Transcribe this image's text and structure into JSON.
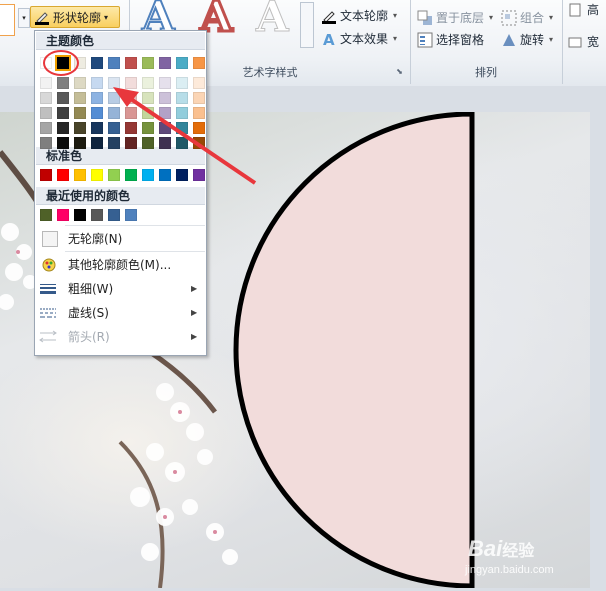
{
  "ribbon": {
    "shape_outline_label": "形状轮廓",
    "text_outline_label": "文本轮廓",
    "text_effects_label": "文本效果",
    "wordart_group_label": "艺术字样式",
    "send_to_back_label": "置于底层",
    "group_label": "组合",
    "selection_pane_label": "选择窗格",
    "rotate_label": "旋转",
    "arrange_group_label": "排列",
    "height_label": "高",
    "width_label": "宽",
    "wordart_glyph": "A"
  },
  "menu": {
    "theme_colors_header": "主题颜色",
    "standard_colors_header": "标准色",
    "recent_colors_header": "最近使用的颜色",
    "no_outline_label": "无轮廓(N)",
    "more_colors_label": "其他轮廓颜色(M)...",
    "weight_label": "粗细(W)",
    "dashes_label": "虚线(S)",
    "arrows_label": "箭头(R)",
    "theme_top_row": [
      "#ffffff",
      "#000000",
      "#eeece1",
      "#1f497d",
      "#4f81bd",
      "#c0504d",
      "#9bbb59",
      "#8064a2",
      "#4bacc6",
      "#f79646"
    ],
    "theme_shades": [
      [
        "#f2f2f2",
        "#7f7f7f",
        "#ddd9c3",
        "#c6d9f0",
        "#dbe5f1",
        "#f2dcdb",
        "#ebf1dd",
        "#e5e0ec",
        "#dbeef3",
        "#fdeada"
      ],
      [
        "#d8d8d8",
        "#595959",
        "#c4bd97",
        "#8db3e2",
        "#b8cce4",
        "#e5b9b7",
        "#d7e3bc",
        "#ccc1d9",
        "#b7dde8",
        "#fbd5b5"
      ],
      [
        "#bfbfbf",
        "#3f3f3f",
        "#938953",
        "#548dd4",
        "#95b3d7",
        "#d99694",
        "#c3d69b",
        "#b2a2c7",
        "#92cddc",
        "#fac08f"
      ],
      [
        "#a5a5a5",
        "#262626",
        "#494429",
        "#17365d",
        "#366092",
        "#953734",
        "#76923c",
        "#5f497a",
        "#31859b",
        "#e36c09"
      ],
      [
        "#7f7f7f",
        "#0c0c0c",
        "#1d1b10",
        "#0f243e",
        "#244061",
        "#632423",
        "#4f6128",
        "#3f3151",
        "#205867",
        "#974806"
      ]
    ],
    "standard_colors": [
      "#c00000",
      "#ff0000",
      "#ffc000",
      "#ffff00",
      "#92d050",
      "#00b050",
      "#00b0f0",
      "#0070c0",
      "#002060",
      "#7030a0"
    ],
    "recent_colors": [
      "#4f6128",
      "#ff0066",
      "#000000",
      "#595959",
      "#366092",
      "#4f81bd"
    ]
  },
  "slide": {
    "shape_fill": "#f2dcdb",
    "shape_outline": "#000000"
  },
  "annotation": {
    "color": "#e8373c"
  },
  "watermark": {
    "brand": "Bai",
    "brand_suffix": "经验",
    "url": "jingyan.baidu.com"
  }
}
